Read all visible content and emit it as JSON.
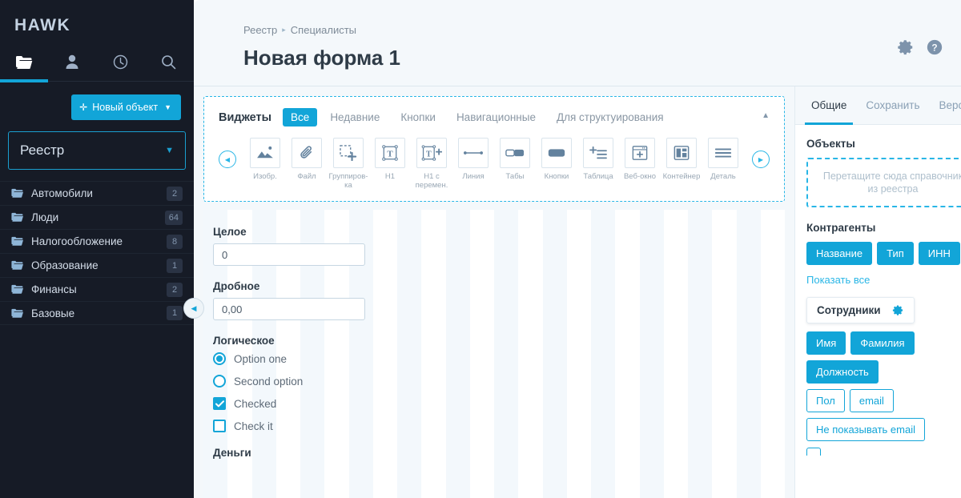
{
  "sidebar": {
    "brand": "HAWK",
    "nav": [
      {
        "name": "folder-icon",
        "label": "Объекты",
        "active": true
      },
      {
        "name": "user-icon",
        "label": "Пользователи",
        "active": false
      },
      {
        "name": "clock-icon",
        "label": "История",
        "active": false
      },
      {
        "name": "search-icon",
        "label": "Поиск",
        "active": false
      }
    ],
    "new_object_button": "Новый объект",
    "new_object_plus": "✛",
    "registry_select": "Реестр",
    "tree": [
      {
        "label": "Автомобили",
        "count": "2"
      },
      {
        "label": "Люди",
        "count": "64"
      },
      {
        "label": "Налогообложение",
        "count": "8"
      },
      {
        "label": "Образование",
        "count": "1"
      },
      {
        "label": "Финансы",
        "count": "2"
      },
      {
        "label": "Базовые",
        "count": "1"
      }
    ]
  },
  "header": {
    "breadcrumb": [
      {
        "label": "Реестр"
      },
      {
        "label": "Специалисты"
      }
    ],
    "breadcrumb_separator": "▸",
    "title": "Новая форма 1",
    "icons": [
      {
        "name": "gear-icon"
      },
      {
        "name": "help-icon"
      }
    ]
  },
  "widgets": {
    "title": "Виджеты",
    "tabs": [
      {
        "label": "Все",
        "active": true
      },
      {
        "label": "Недавние",
        "active": false
      },
      {
        "label": "Кнопки",
        "active": false
      },
      {
        "label": "Навигационные",
        "active": false
      },
      {
        "label": "Для структуирования",
        "active": false
      }
    ],
    "collapse_icon": "▲",
    "prev_arrow": "◀",
    "next_arrow": "▶",
    "items": [
      {
        "label": "Изобр.",
        "icon": "image-icon"
      },
      {
        "label": "Файл",
        "icon": "paperclip-icon"
      },
      {
        "label": "Группиров-ка",
        "icon": "group-icon"
      },
      {
        "label": "H1",
        "icon": "heading-icon"
      },
      {
        "label": "H1 с перемен.",
        "icon": "heading-variable-icon"
      },
      {
        "label": "Линия",
        "icon": "line-icon"
      },
      {
        "label": "Табы",
        "icon": "tabs-icon"
      },
      {
        "label": "Кнопки",
        "icon": "button-icon"
      },
      {
        "label": "Таблица",
        "icon": "table-icon"
      },
      {
        "label": "Веб-окно",
        "icon": "web-window-icon"
      },
      {
        "label": "Контейнер",
        "icon": "container-icon"
      },
      {
        "label": "Деталь",
        "icon": "detail-icon"
      }
    ]
  },
  "form": {
    "fields": [
      {
        "label": "Целое",
        "value": "0",
        "type": "input"
      },
      {
        "label": "Дробное",
        "value": "0,00",
        "type": "input"
      }
    ],
    "logical_label": "Логическое",
    "options": [
      {
        "label": "Option one",
        "type": "radio",
        "checked": true
      },
      {
        "label": "Second option",
        "type": "radio",
        "checked": false
      },
      {
        "label": "Checked",
        "type": "checkbox",
        "checked": true
      },
      {
        "label": "Check it",
        "type": "checkbox",
        "checked": false
      }
    ],
    "money_label": "Деньги"
  },
  "rightpanel": {
    "tabs": [
      {
        "label": "Общие",
        "active": true
      },
      {
        "label": "Сохранить",
        "active": false
      },
      {
        "label": "Версии",
        "active": false
      }
    ],
    "objects_title": "Объекты",
    "dropzone_text": "Перетащите сюда справочник из реестра",
    "counterparties_title": "Контрагенты",
    "counterparties_tags": [
      "Название",
      "Тип",
      "ИНН"
    ],
    "show_all": "Показать все",
    "employees_card": {
      "title": "Сотрудники",
      "gear_icon": "gear-icon"
    },
    "employees_tags": [
      {
        "label": "Имя",
        "filled": true
      },
      {
        "label": "Фамилия",
        "filled": true
      },
      {
        "label": "Должность",
        "filled": true
      },
      {
        "label": "Пол",
        "filled": false
      },
      {
        "label": "email",
        "filled": false
      },
      {
        "label": "Не показывать email",
        "filled": false
      }
    ]
  },
  "colors": {
    "accent": "#12a5d8",
    "accent_light": "#29b6e6",
    "sidebar_bg": "#161b26",
    "main_bg": "#f4f8fb",
    "text_dark": "#2e3b47"
  }
}
